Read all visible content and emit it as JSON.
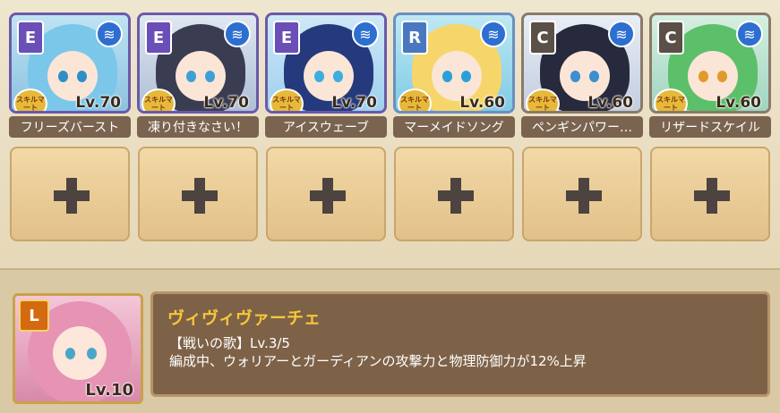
{
  "party": [
    {
      "rank": "E",
      "lv": "Lv.70",
      "skill": "フリーズバースト",
      "stamp": "スキルマート"
    },
    {
      "rank": "E",
      "lv": "Lv.70",
      "skill": "凍り付きなさい！",
      "stamp": "スキルマート"
    },
    {
      "rank": "E",
      "lv": "Lv.70",
      "skill": "アイスウェーブ",
      "stamp": "スキルマート"
    },
    {
      "rank": "R",
      "lv": "Lv.60",
      "skill": "マーメイドソング",
      "stamp": "スキルマート"
    },
    {
      "rank": "C",
      "lv": "Lv.60",
      "skill": "ペンギンパワー…",
      "stamp": "スキルマート"
    },
    {
      "rank": "C",
      "lv": "Lv.60",
      "skill": "リザードスケイル",
      "stamp": "スキルマート"
    }
  ],
  "icons": {
    "element": "water-element-icon",
    "add": "plus-icon"
  },
  "leader": {
    "badge": "L",
    "lv": "Lv.10",
    "name": "ヴィヴィヴァーチェ",
    "skill_line": "【戦いの歌】Lv.3/5",
    "skill_desc": "編成中、ウォリアーとガーディアンの攻撃力と物理防御力が12%上昇"
  },
  "colors": {
    "accent_name": "#f7c63a",
    "panel": "#7d6248",
    "slot": "#e3c089"
  }
}
